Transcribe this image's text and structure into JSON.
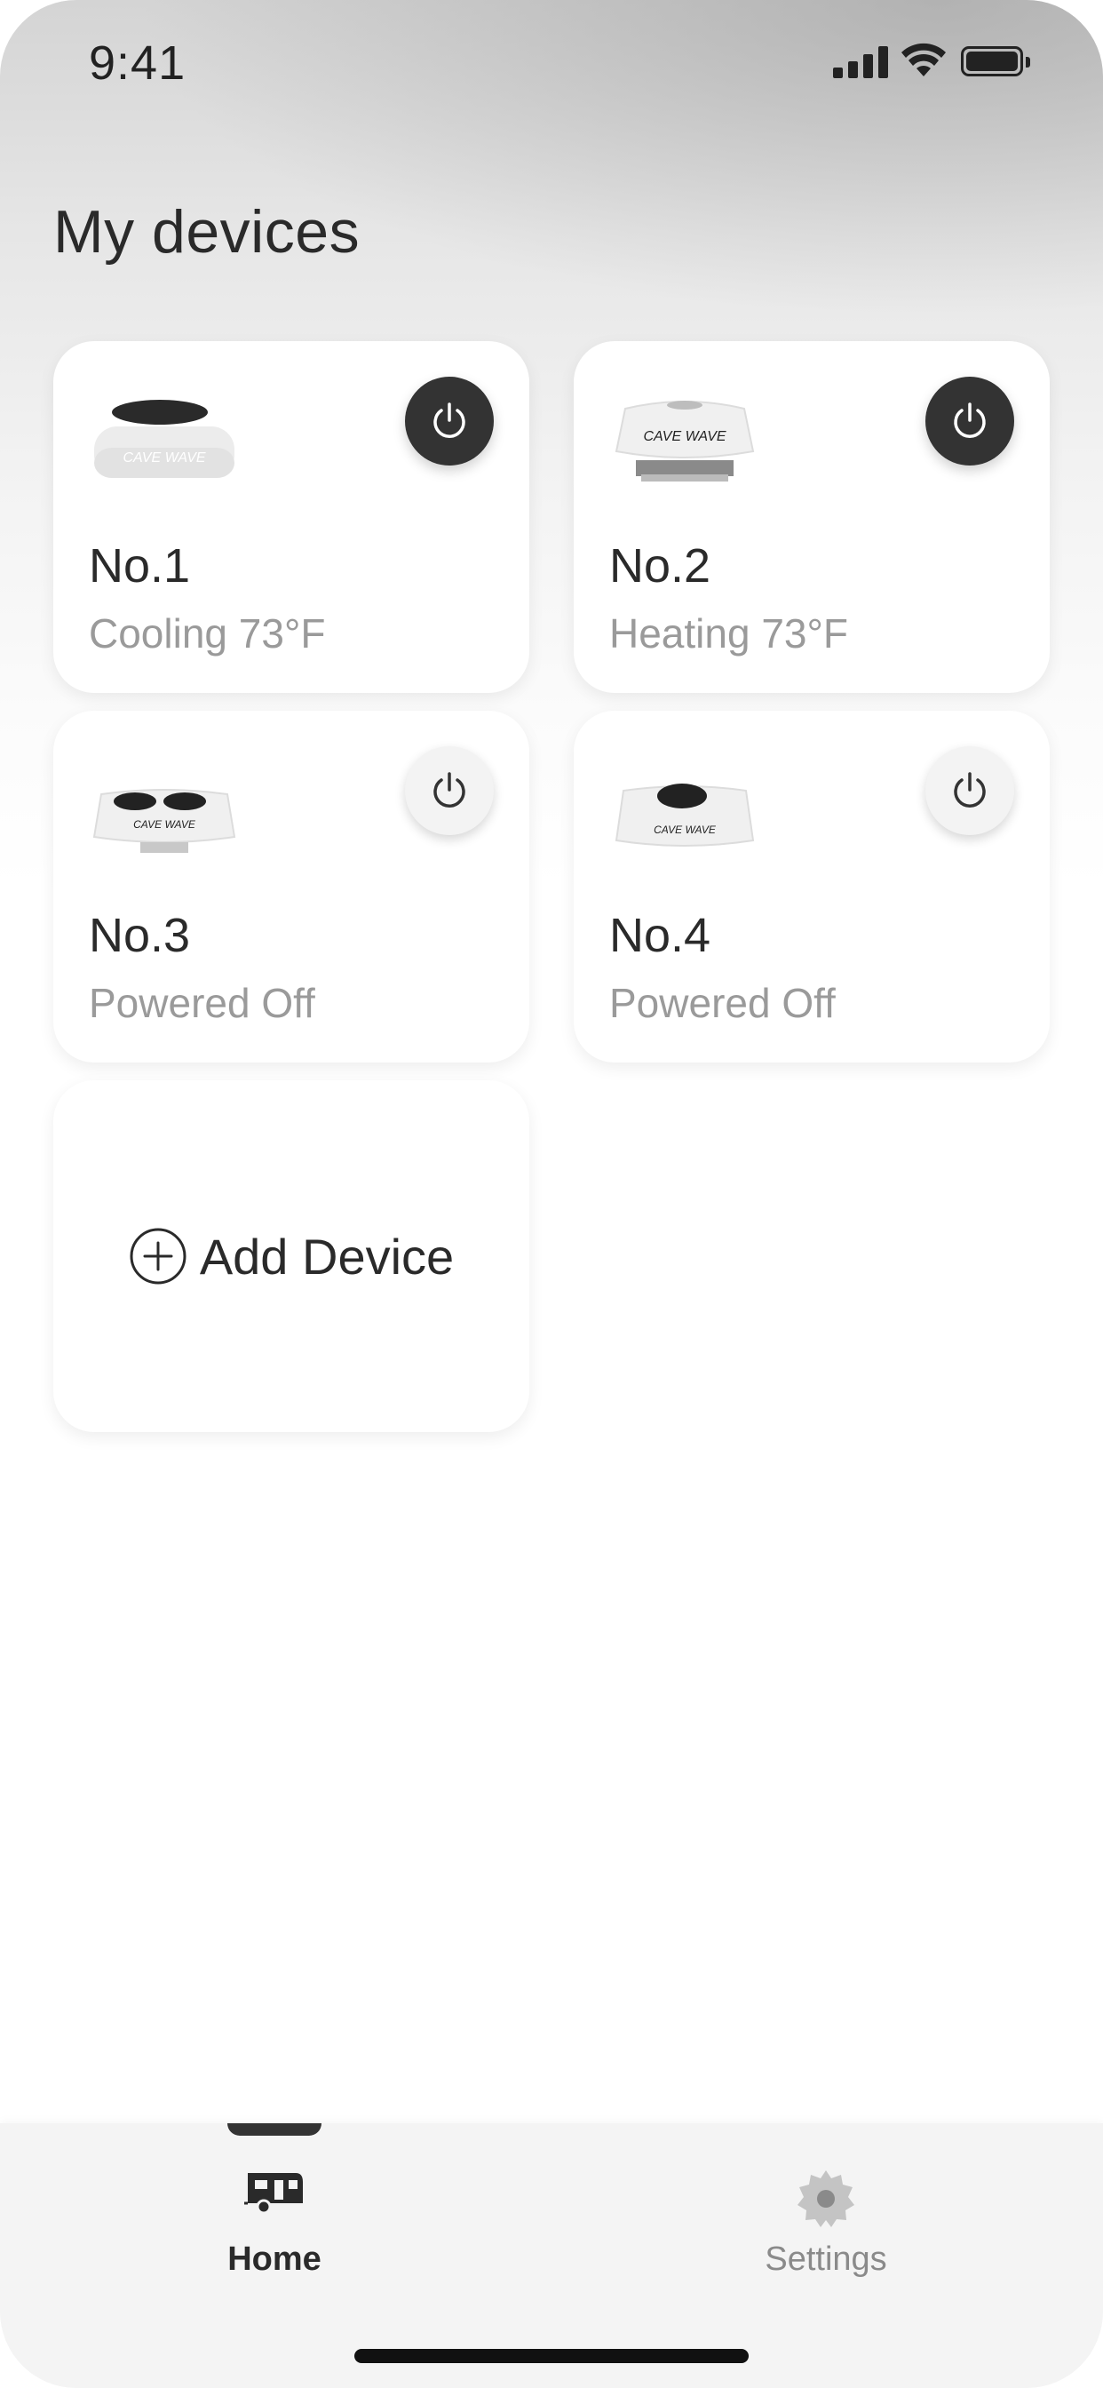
{
  "status_bar": {
    "time": "9:41"
  },
  "header": {
    "title": "My devices"
  },
  "devices": [
    {
      "name": "No.1",
      "state": "Cooling 73°F",
      "powered": true,
      "brand": "CAVE WAVE"
    },
    {
      "name": "No.2",
      "state": "Heating 73°F",
      "powered": true,
      "brand": "CAVE WAVE"
    },
    {
      "name": "No.3",
      "state": "Powered Off",
      "powered": false,
      "brand": "CAVE WAVE"
    },
    {
      "name": "No.4",
      "state": "Powered Off",
      "powered": false,
      "brand": "CAVE WAVE"
    }
  ],
  "add_device": {
    "label": "Add Device"
  },
  "tabbar": {
    "tabs": [
      {
        "label": "Home",
        "icon": "camper-icon",
        "active": true
      },
      {
        "label": "Settings",
        "icon": "gear-icon",
        "active": false
      }
    ]
  },
  "colors": {
    "power_on": "#333333",
    "power_off": "#f3f3f3",
    "text_primary": "#2a2a2a",
    "text_secondary": "#9a9a9a"
  }
}
